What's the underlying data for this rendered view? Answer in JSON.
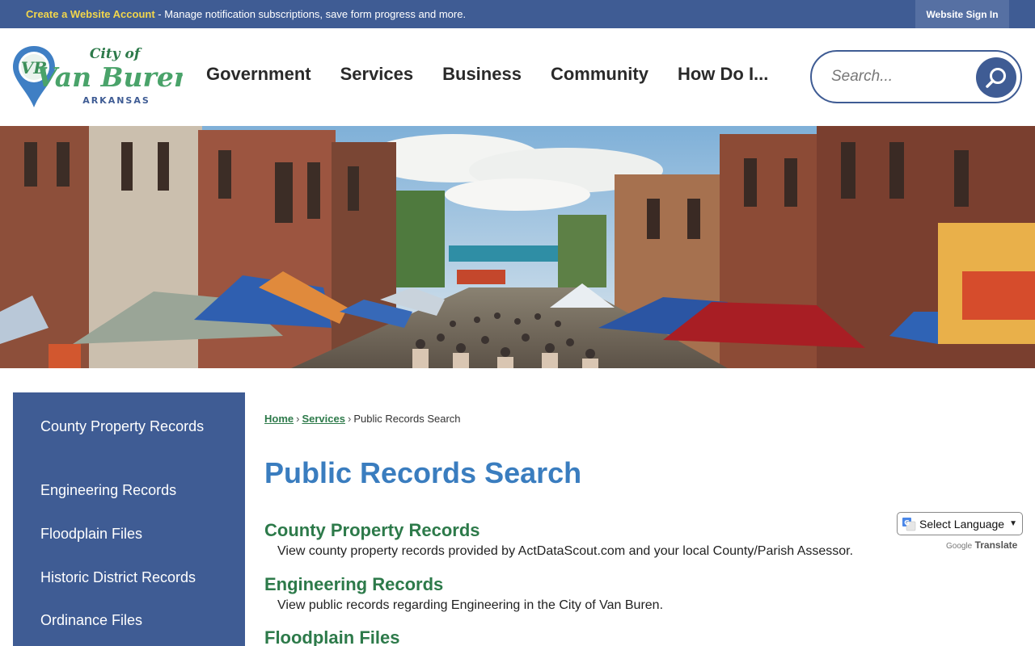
{
  "topbar": {
    "create_account_label": "Create a Website Account",
    "message": " - Manage notification subscriptions, save form progress and more.",
    "signin_label": "Website Sign In"
  },
  "logo": {
    "city_of": "City of",
    "name": "Van Buren",
    "state": "ARKANSAS",
    "monogram": "VB"
  },
  "nav": {
    "items": [
      "Government",
      "Services",
      "Business",
      "Community",
      "How Do I..."
    ]
  },
  "search": {
    "placeholder": "Search..."
  },
  "sidebar": {
    "items": [
      {
        "label": "County Property Records"
      },
      {
        "label": "Engineering Records"
      },
      {
        "label": "Floodplain Files"
      },
      {
        "label": "Historic District Records"
      },
      {
        "label": "Ordinance Files"
      }
    ]
  },
  "breadcrumb": {
    "home": "Home",
    "services": "Services",
    "current": "Public Records Search",
    "separator": "›"
  },
  "page": {
    "title": "Public Records Search"
  },
  "records": [
    {
      "title": "County Property Records",
      "description": "View county property records provided by ActDataScout.com and your local County/Parish Assessor."
    },
    {
      "title": "Engineering Records",
      "description": "View public records regarding Engineering in the City of Van Buren."
    },
    {
      "title": "Floodplain Files",
      "description": ""
    }
  ],
  "translate": {
    "select_label": "Select Language",
    "powered_google": "Google",
    "powered_translate": "Translate"
  },
  "colors": {
    "brand_blue": "#3f5c94",
    "title_blue": "#3a7dbf",
    "accent_green": "#2d7a4a",
    "highlight_yellow": "#f2d64b"
  },
  "icons": [
    "search-icon",
    "map-pin-logo-icon",
    "google-translate-icon",
    "chevron-down-icon"
  ]
}
